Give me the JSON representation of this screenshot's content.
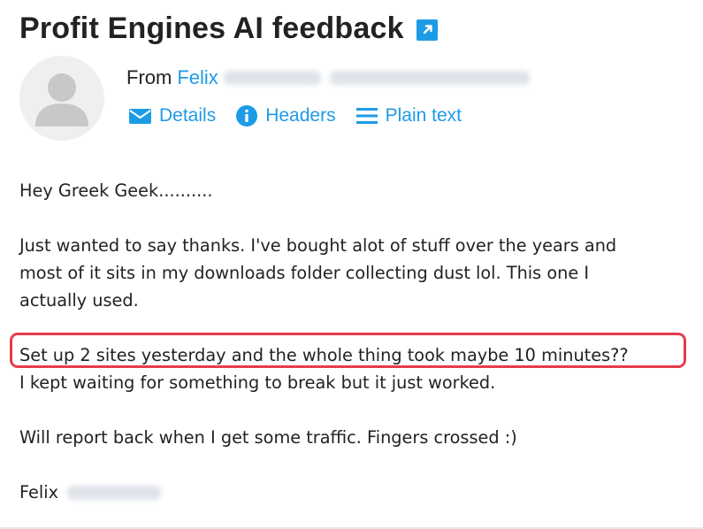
{
  "email": {
    "subject": "Profit Engines AI feedback",
    "from_label": "From",
    "from_name": "Felix",
    "links": {
      "details": "Details",
      "headers": "Headers",
      "plain_text": "Plain text"
    },
    "body": {
      "greeting": "Hey Greek Geek..........",
      "para1_line1": "Just wanted to say thanks. I've bought alot of stuff over the years and",
      "para1_line2": "most of it sits in my downloads folder collecting dust lol. This one I",
      "para1_line3": "actually used.",
      "para2_line1": "Set up 2 sites yesterday and the whole thing took maybe 10 minutes??",
      "para2_line2": "I kept waiting for something to break but it just worked.",
      "para3": "Will report back when I get some traffic. Fingers crossed :)",
      "signature": "Felix"
    }
  },
  "colors": {
    "link": "#1e9be6",
    "highlight_border": "#e63c4d",
    "text": "#222222"
  },
  "icons": {
    "external_link": "external-link-icon",
    "avatar": "user-avatar-icon",
    "details": "envelope-icon",
    "headers": "info-icon",
    "plain_text": "lines-icon"
  }
}
